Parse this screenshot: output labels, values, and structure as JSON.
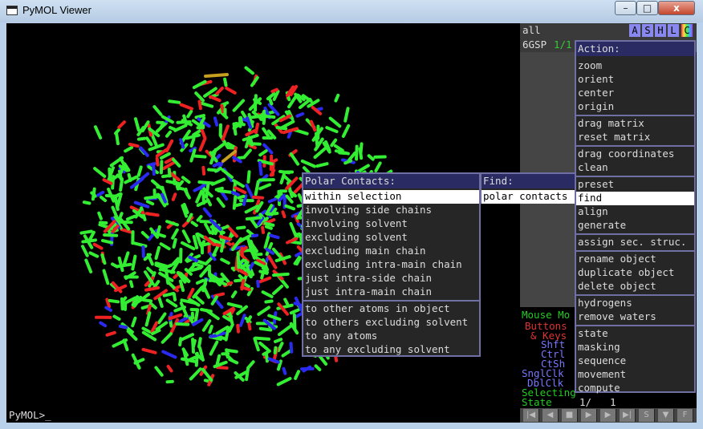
{
  "window": {
    "title": "PyMOL Viewer",
    "minimize": "–",
    "maximize": "□",
    "close": "x"
  },
  "command_line": {
    "prompt": "PyMOL>_"
  },
  "object_panel": {
    "all_label": "all",
    "buttons": [
      "A",
      "S",
      "H",
      "L",
      "C"
    ],
    "object_name": "6GSP",
    "object_state": "1/1"
  },
  "mouse_panel": {
    "title": "Mouse Mo",
    "buttons_label": "Buttons",
    "keys_label": "& Keys",
    "shft": "Shft",
    "ctrl": "Ctrl",
    "ctsh": "CtSh",
    "snglclk": "SnglClk",
    "dblclk": "DblClk",
    "selecting": "Selecting",
    "state_label": "State",
    "state_value": "1/",
    "state_total": "1"
  },
  "playback": [
    "|◀",
    "◀",
    "■",
    "▶",
    "▶",
    "▶|",
    "S",
    "▼",
    "F"
  ],
  "action_menu": {
    "title": "Action:",
    "groups": [
      [
        "zoom",
        "orient",
        "center",
        "origin"
      ],
      [
        "drag matrix",
        "reset matrix"
      ],
      [
        "drag coordinates",
        "clean"
      ],
      [
        "preset",
        "find",
        "align",
        "generate"
      ],
      [
        "assign sec. struc."
      ],
      [
        "rename object",
        "duplicate object",
        "delete object"
      ],
      [
        "hydrogens",
        "remove waters"
      ],
      [
        "state",
        "masking",
        "sequence",
        "movement",
        "compute"
      ]
    ],
    "selected": "find"
  },
  "find_menu": {
    "title": "Find:",
    "items": [
      "polar contacts"
    ]
  },
  "polar_menu": {
    "title": "Polar Contacts:",
    "groups": [
      [
        "within selection",
        "involving side chains",
        "involving solvent",
        "excluding solvent",
        "excluding main chain",
        "excluding intra-main chain",
        "just intra-side chain",
        "just intra-main chain"
      ],
      [
        "to other atoms in object",
        "to others excluding solvent",
        "to any atoms",
        "to any excluding solvent"
      ]
    ],
    "selected": "within selection"
  },
  "colors": {
    "carbon": "#33ee33",
    "nitrogen": "#2a2af0",
    "oxygen": "#ee2222",
    "sulfur": "#c8a020",
    "menu_header": "#2b2b63",
    "menu_border": "#6f6fa4",
    "mouse_title": "#22cc22",
    "buttons_label": "#dd3333",
    "modifier_keys": "#7777ff"
  }
}
